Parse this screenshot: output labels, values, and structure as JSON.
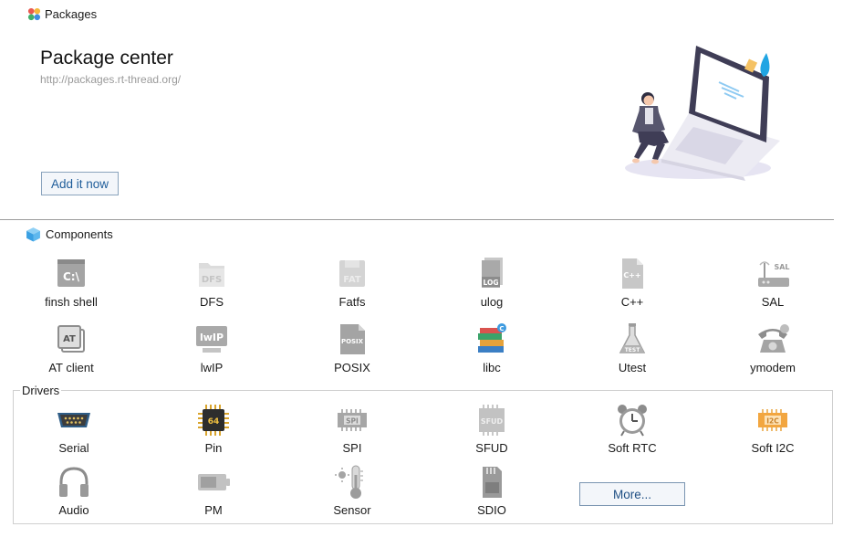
{
  "window": {
    "title": "Packages",
    "icon": "packages-icon"
  },
  "hero": {
    "title": "Package center",
    "url": "http://packages.rt-thread.org/",
    "add_button": "Add it now"
  },
  "components": {
    "title": "Components",
    "icon": "cube-icon",
    "items": [
      {
        "label": "finsh shell",
        "icon": "terminal-icon"
      },
      {
        "label": "DFS",
        "icon": "dfs-folder-icon"
      },
      {
        "label": "Fatfs",
        "icon": "fat-disk-icon"
      },
      {
        "label": "ulog",
        "icon": "log-file-icon"
      },
      {
        "label": "C++",
        "icon": "cpp-file-icon"
      },
      {
        "label": "SAL",
        "icon": "router-icon"
      },
      {
        "label": "AT client",
        "icon": "at-icon"
      },
      {
        "label": "lwIP",
        "icon": "lwip-icon"
      },
      {
        "label": "POSIX",
        "icon": "posix-file-icon"
      },
      {
        "label": "libc",
        "icon": "books-icon"
      },
      {
        "label": "Utest",
        "icon": "flask-icon"
      },
      {
        "label": "ymodem",
        "icon": "telephone-icon"
      }
    ]
  },
  "drivers": {
    "title": "Drivers",
    "items": [
      {
        "label": "Serial",
        "icon": "serial-port-icon"
      },
      {
        "label": "Pin",
        "icon": "chip-icon",
        "chip_text": "64"
      },
      {
        "label": "SPI",
        "icon": "spi-icon",
        "chip_text": "SPI"
      },
      {
        "label": "SFUD",
        "icon": "sfud-icon",
        "chip_text": "SFUD"
      },
      {
        "label": "Soft RTC",
        "icon": "alarm-clock-icon"
      },
      {
        "label": "Soft I2C",
        "icon": "i2c-icon",
        "chip_text": "I2C"
      },
      {
        "label": "Audio",
        "icon": "headphones-icon"
      },
      {
        "label": "PM",
        "icon": "battery-icon"
      },
      {
        "label": "Sensor",
        "icon": "thermometer-icon"
      },
      {
        "label": "SDIO",
        "icon": "sd-card-icon"
      }
    ],
    "more_button": "More..."
  }
}
